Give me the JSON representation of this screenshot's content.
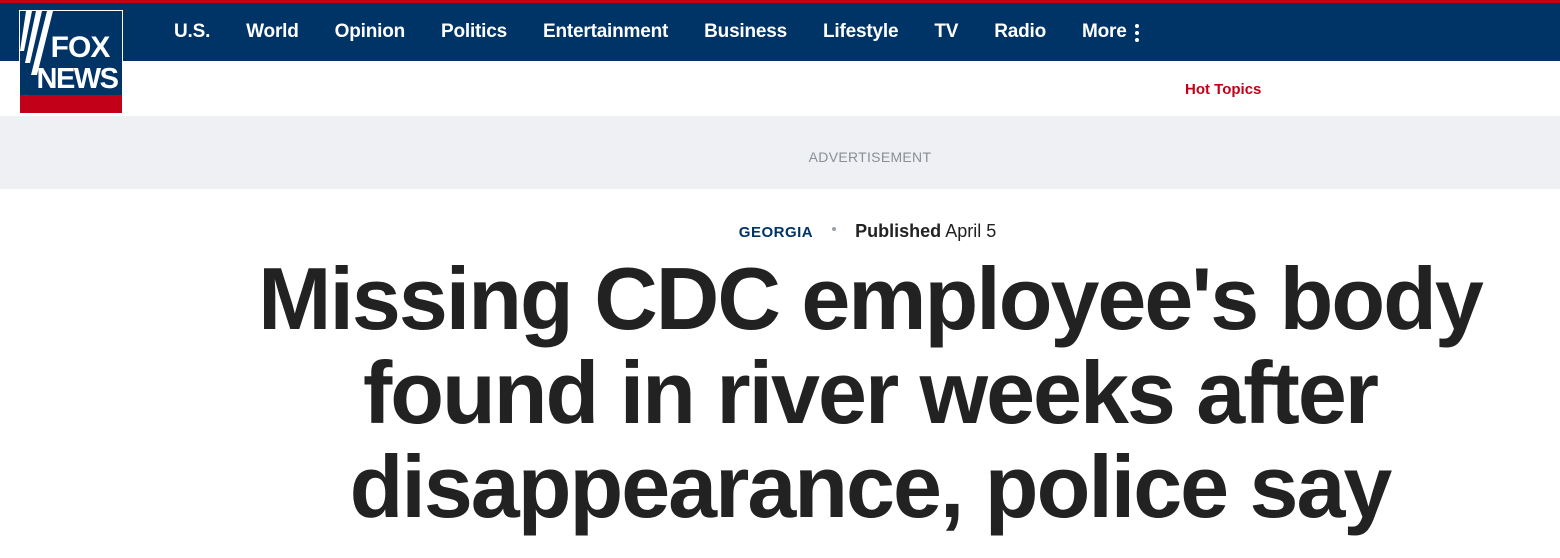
{
  "brand": {
    "logo_text_top": "FOX",
    "logo_text_bottom": "NEWS",
    "colors": {
      "navy": "#003366",
      "red": "#c20017",
      "headline": "#222222",
      "ad_bg": "#eef0f3"
    }
  },
  "nav": {
    "items": [
      "U.S.",
      "World",
      "Opinion",
      "Politics",
      "Entertainment",
      "Business",
      "Lifestyle",
      "TV",
      "Radio"
    ],
    "more_label": "More",
    "more_icon": "kebab-vertical-icon"
  },
  "subheader": {
    "hot_topics": "Hot Topics"
  },
  "ad": {
    "label": "ADVERTISEMENT"
  },
  "article": {
    "eyebrow": "GEORGIA",
    "published_label": "Published",
    "published_date": "April 5",
    "headline": "Missing CDC employee's body found in river weeks after disappearance, police say"
  }
}
